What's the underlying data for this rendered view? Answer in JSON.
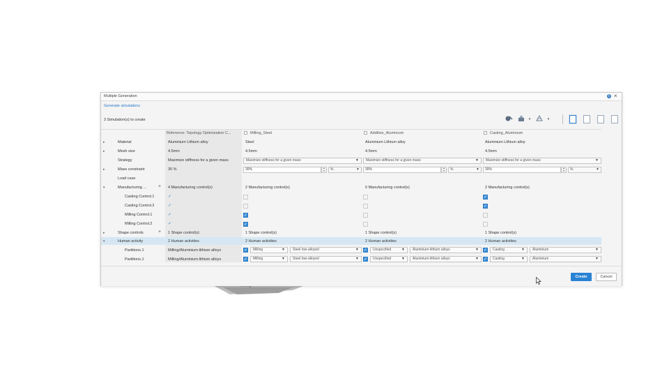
{
  "dialog": {
    "title": "Multiple Generation",
    "link": "Generate simulations",
    "count": "3 Simulation(s) to create",
    "colors": {
      "accent": "#2a82d4",
      "highlight": "#d6e7f3"
    }
  },
  "toolbar": {
    "icons": [
      "generate-icon",
      "material-icon",
      "mesh-icon",
      "page-select-icon",
      "page-new-icon",
      "page-copy-icon",
      "page-text-icon"
    ],
    "dropdown_glyph": "▾"
  },
  "columns": {
    "reference": "Reference: Topology Optimization C...",
    "c1": "Milling_Steel",
    "c2": "Additive_Aluminium",
    "c3": "Casting_Aluminium"
  },
  "rows": {
    "material": "Material",
    "mesh_size": "Mesh size",
    "strategy": "Strategy",
    "mass_constraint": "Mass constraint",
    "load_case": "Load case",
    "manufacturing": "Manufacturing ...",
    "casting1": "Casting Control.1",
    "casting2": "Casting Control.2",
    "milling1": "Milling Control.1",
    "milling2": "Milling Control.2",
    "shape_controls": "Shape controls",
    "human_activity": "Human activity",
    "partitions1": "Partitions.1",
    "partitions2": "Partitions.1"
  },
  "ref": {
    "material": "Aluminium Lithium alloy",
    "mesh": "4.5mm",
    "strategy": "Maximize stiffness for a given mass",
    "mass": "30 %",
    "manufacturing": "4 Manufacturing control(s)",
    "shape": "1 Shape control(s)",
    "human": "2 Human activities",
    "p1": "Milling/Aluminium-lithium alloys",
    "p2": "Milling/Aluminium-lithium alloys"
  },
  "c1": {
    "material": "Steel",
    "mesh": "4.5mm",
    "strategy": "Maximize stiffness for a given mass",
    "mass": "30%",
    "unit": "%",
    "manufacturing": "2 Manufacturing control(s)",
    "shape": "1 Shape control(s)",
    "human": "2 Human activities",
    "p1_process": "Milling",
    "p1_material": "Steel low-alloyed",
    "p2_process": "Milling",
    "p2_material": "Steel low-alloyed"
  },
  "c2": {
    "material": "Aluminium Lithium alloy",
    "mesh": "4.5mm",
    "strategy": "Maximize stiffness for a given mass",
    "mass": "30%",
    "unit": "%",
    "manufacturing": "0 Manufacturing control(s)",
    "shape": "1 Shape control(s)",
    "human": "2 Human activities",
    "p1_process": "Unspecified",
    "p1_material": "Aluminium-lithium alloys",
    "p2_process": "Unspecified",
    "p2_material": "Aluminium-lithium alloys"
  },
  "c3": {
    "material": "Aluminium Lithium alloy",
    "mesh": "4.5mm",
    "strategy": "Maximize stiffness for a given mass",
    "mass": "30%",
    "unit": "%",
    "manufacturing": "2 Manufacturing control(s)",
    "shape": "1 Shape control(s)",
    "human": "2 Human activities",
    "p1_process": "Casting",
    "p1_material": "Aluminium",
    "p2_process": "Casting",
    "p2_material": "Aluminium"
  },
  "footer": {
    "create": "Create",
    "cancel": "Cancel"
  },
  "glyphs": {
    "expand": "▸",
    "collapse": "▾",
    "plus": "+",
    "check": "✓",
    "up": "▲",
    "down": "▼",
    "caret": "▾"
  }
}
